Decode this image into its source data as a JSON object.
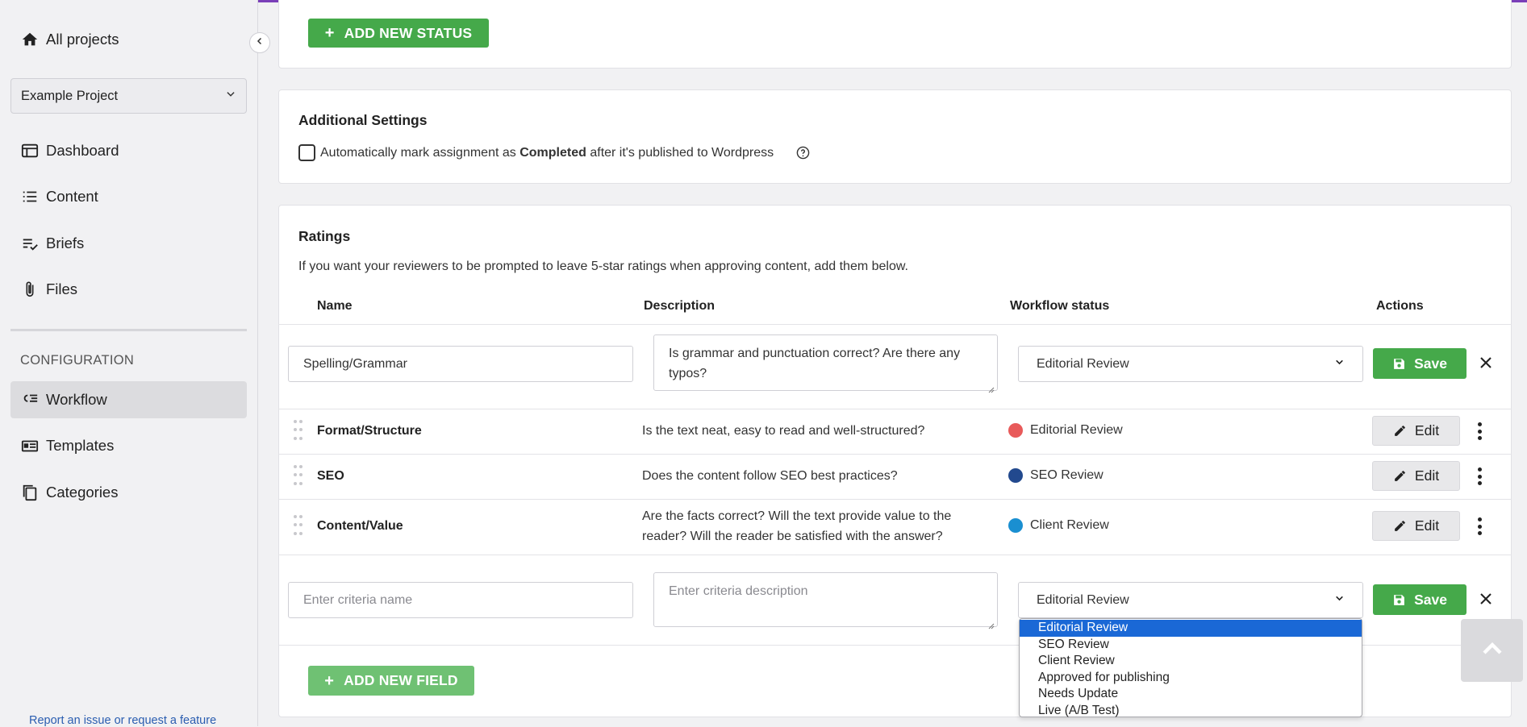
{
  "sidebar": {
    "all_projects": "All projects",
    "project_select": "Example Project",
    "nav": [
      {
        "label": "Dashboard",
        "icon": "dashboard-icon"
      },
      {
        "label": "Content",
        "icon": "list-icon"
      },
      {
        "label": "Briefs",
        "icon": "checklist-icon"
      },
      {
        "label": "Files",
        "icon": "paperclip-icon"
      }
    ],
    "config_label": "CONFIGURATION",
    "config_nav": [
      {
        "label": "Workflow",
        "icon": "workflow-icon",
        "active": true
      },
      {
        "label": "Templates",
        "icon": "template-icon"
      },
      {
        "label": "Categories",
        "icon": "copy-icon"
      }
    ],
    "report_link": "Report an issue or request a feature"
  },
  "status_section": {
    "add_status_label": "ADD NEW STATUS"
  },
  "additional_settings": {
    "title": "Additional Settings",
    "checkbox_pre": "Automatically mark assignment as",
    "checkbox_bold": "Completed",
    "checkbox_post": "after it's published to Wordpress",
    "checked": false
  },
  "ratings": {
    "title": "Ratings",
    "description": "If you want your reviewers to be prompted to leave 5-star ratings when approving content, add them below.",
    "columns": {
      "name": "Name",
      "description": "Description",
      "workflow_status": "Workflow status",
      "actions": "Actions"
    },
    "editing_row": {
      "name_value": "Spelling/Grammar",
      "description_value": "Is grammar and punctuation correct? Are there any typos?",
      "status_value": "Editorial Review",
      "save_label": "Save"
    },
    "rows": [
      {
        "name": "Format/Structure",
        "description": "Is the text neat, easy to read and well-structured?",
        "status": "Editorial Review",
        "status_color": "#e85a5a",
        "edit_label": "Edit"
      },
      {
        "name": "SEO",
        "description": "Does the content follow SEO best practices?",
        "status": "SEO Review",
        "status_color": "#22498e",
        "edit_label": "Edit"
      },
      {
        "name": "Content/Value",
        "description": "Are the facts correct? Will the text provide value to the reader? Will the reader be satisfied with the answer?",
        "status": "Client Review",
        "status_color": "#1a8fd1",
        "edit_label": "Edit"
      }
    ],
    "new_row": {
      "name_placeholder": "Enter criteria name",
      "description_placeholder": "Enter criteria description",
      "status_value": "Editorial Review",
      "save_label": "Save"
    },
    "dropdown_options": [
      "Editorial Review",
      "SEO Review",
      "Client Review",
      "Approved for publishing",
      "Needs Update",
      "Live (A/B Test)"
    ],
    "dropdown_selected": "Editorial Review",
    "add_field_label": "ADD NEW FIELD"
  },
  "colors": {
    "accent_green": "#45a94a",
    "top_border": "#7a3fb8",
    "dropdown_highlight": "#1a68d6"
  }
}
